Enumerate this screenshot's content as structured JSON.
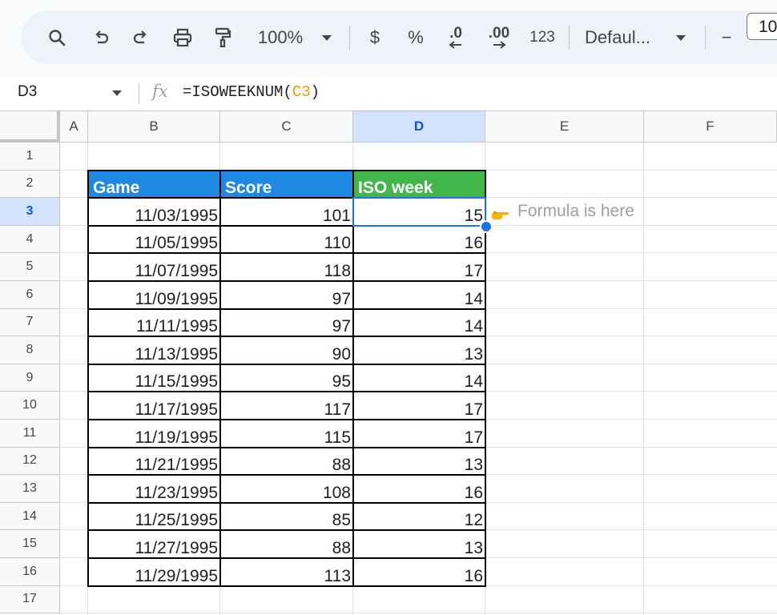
{
  "toolbar": {
    "zoom": "100%",
    "currency": "$",
    "percent": "%",
    "decrease_decimal": ".0",
    "increase_decimal": ".00",
    "number_format": "123",
    "font": "Defaul...",
    "font_size_minus": "−",
    "font_size": "10"
  },
  "formula_bar": {
    "cell_ref": "D3",
    "fx": "fx",
    "formula_prefix": "=ISOWEEKNUM(",
    "formula_ref": "C3",
    "formula_suffix": ")"
  },
  "columns": [
    "A",
    "B",
    "C",
    "D",
    "E",
    "F"
  ],
  "rows": [
    "1",
    "2",
    "3",
    "4",
    "5",
    "6",
    "7",
    "8",
    "9",
    "10",
    "11",
    "12",
    "13",
    "14",
    "15",
    "16",
    "17"
  ],
  "table": {
    "headers": [
      "Game",
      "Score",
      "ISO week"
    ],
    "header_colors": [
      "#1e88e5",
      "#1e88e5",
      "#43b649"
    ],
    "rows": [
      [
        "11/03/1995",
        "101",
        "15"
      ],
      [
        "11/05/1995",
        "110",
        "16"
      ],
      [
        "11/07/1995",
        "118",
        "17"
      ],
      [
        "11/09/1995",
        "97",
        "14"
      ],
      [
        "11/11/1995",
        "97",
        "14"
      ],
      [
        "11/13/1995",
        "90",
        "13"
      ],
      [
        "11/15/1995",
        "95",
        "14"
      ],
      [
        "11/17/1995",
        "117",
        "17"
      ],
      [
        "11/19/1995",
        "115",
        "17"
      ],
      [
        "11/21/1995",
        "88",
        "13"
      ],
      [
        "11/23/1995",
        "108",
        "16"
      ],
      [
        "11/25/1995",
        "85",
        "12"
      ],
      [
        "11/27/1995",
        "88",
        "13"
      ],
      [
        "11/29/1995",
        "113",
        "16"
      ]
    ]
  },
  "note": {
    "icon": "pointing-hand-icon",
    "text": "Formula is here"
  },
  "selected": {
    "column": "D",
    "row": "3"
  }
}
